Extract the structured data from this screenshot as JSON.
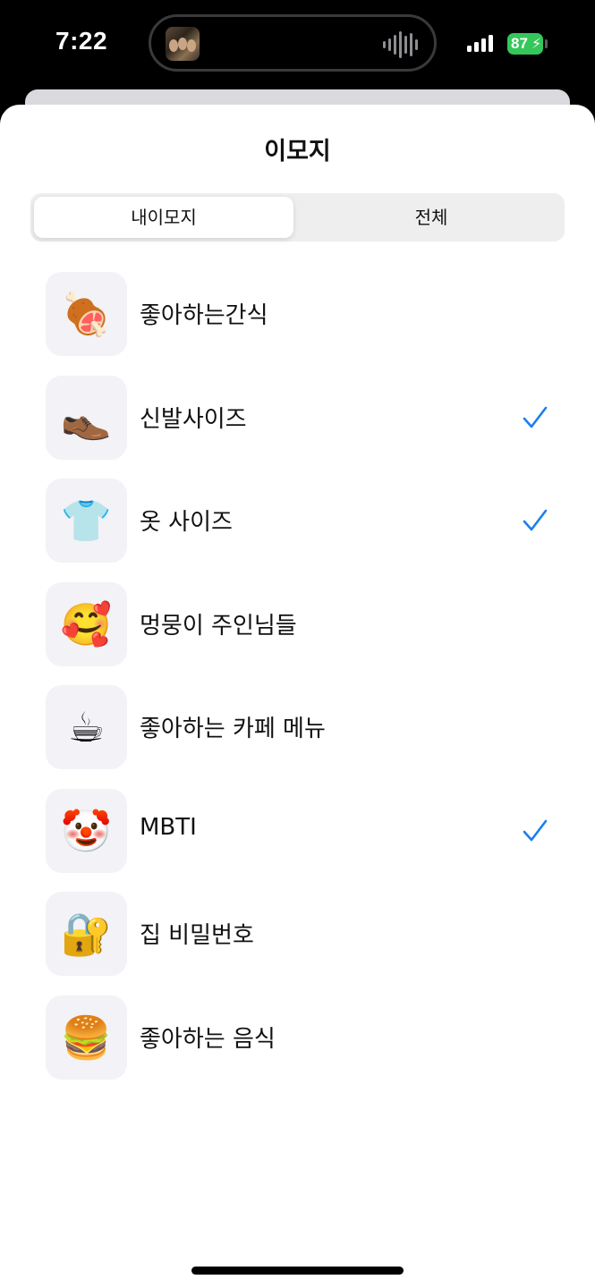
{
  "status_bar": {
    "time": "7:22",
    "battery": "87"
  },
  "sheet": {
    "title": "이모지"
  },
  "tabs": [
    {
      "label": "내이모지",
      "selected": true
    },
    {
      "label": "전체",
      "selected": false
    }
  ],
  "items": [
    {
      "emoji": "🍖",
      "icon": "meat-on-bone-icon",
      "label": "좋아하는간식",
      "checked": false
    },
    {
      "emoji": "👞",
      "icon": "shoe-icon",
      "label": "신발사이즈",
      "checked": true
    },
    {
      "emoji": "👕",
      "icon": "shirt-icon",
      "label": "옷 사이즈",
      "checked": true
    },
    {
      "emoji": "🥰",
      "icon": "smiling-face-with-hearts-icon",
      "label": "멍뭉이 주인님들",
      "checked": false
    },
    {
      "emoji": "☕",
      "icon": "coffee-icon",
      "label": "좋아하는 카페 메뉴",
      "checked": false
    },
    {
      "emoji": "🤡",
      "icon": "clown-face-icon",
      "label": "MBTI",
      "checked": true
    },
    {
      "emoji": "🔐",
      "icon": "lock-with-key-icon",
      "label": "집 비밀번호",
      "checked": false
    },
    {
      "emoji": "🍔",
      "icon": "hamburger-icon",
      "label": "좋아하는 음식",
      "checked": false
    }
  ],
  "colors": {
    "accent": "#1a7ef2",
    "tile_bg": "#f2f2f7",
    "battery": "#34c759"
  }
}
